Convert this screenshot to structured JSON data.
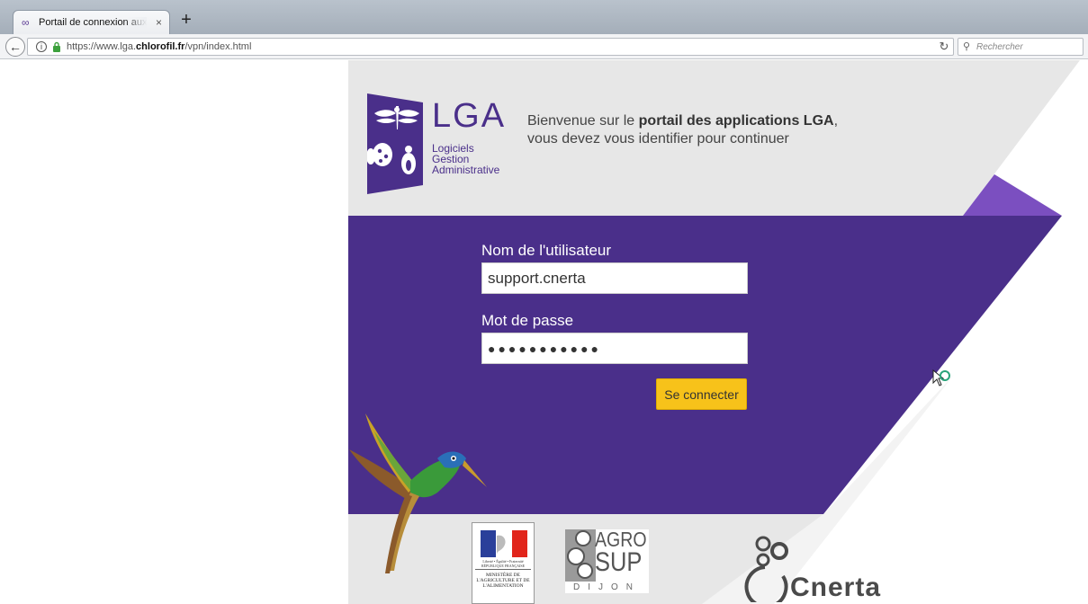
{
  "browser": {
    "tab_title": "Portail de connexion aux applications",
    "tab_close": "×",
    "new_tab": "+",
    "url_prefix": "https://www.lga.",
    "url_domain": "chlorofil.fr",
    "url_path": "/vpn/index.html",
    "search_placeholder": "Rechercher"
  },
  "header": {
    "logo_big": "LGA",
    "logo_line1": "Logiciels",
    "logo_line2": "Gestion",
    "logo_line3": "Administrative",
    "welcome_pre": "Bienvenue sur le ",
    "welcome_bold": "portail des applications LGA",
    "welcome_post": ",",
    "welcome_line2": "vous devez vous identifier pour continuer"
  },
  "form": {
    "username_label": "Nom de l'utilisateur",
    "username_value": "support.cnerta",
    "password_label": "Mot de passe",
    "password_value": "●●●●●●●●●●●",
    "submit_label": "Se connecter"
  },
  "footer": {
    "ministere_motto": "Liberté • Égalité • Fraternité",
    "ministere_republic": "RÉPUBLIQUE FRANÇAISE",
    "ministere_name": "MINISTÈRE DE L'AGRICULTURE ET DE L'ALIMENTATION",
    "agro_line1": "AGRO",
    "agro_line2": "SUP",
    "agro_city": "DIJON",
    "cnerta_name": "Cnerta"
  },
  "colors": {
    "purple": "#4a2f8a",
    "purple_light": "#7b4fc0",
    "yellow": "#f7c21a",
    "grey_bg": "#e7e7e7"
  }
}
